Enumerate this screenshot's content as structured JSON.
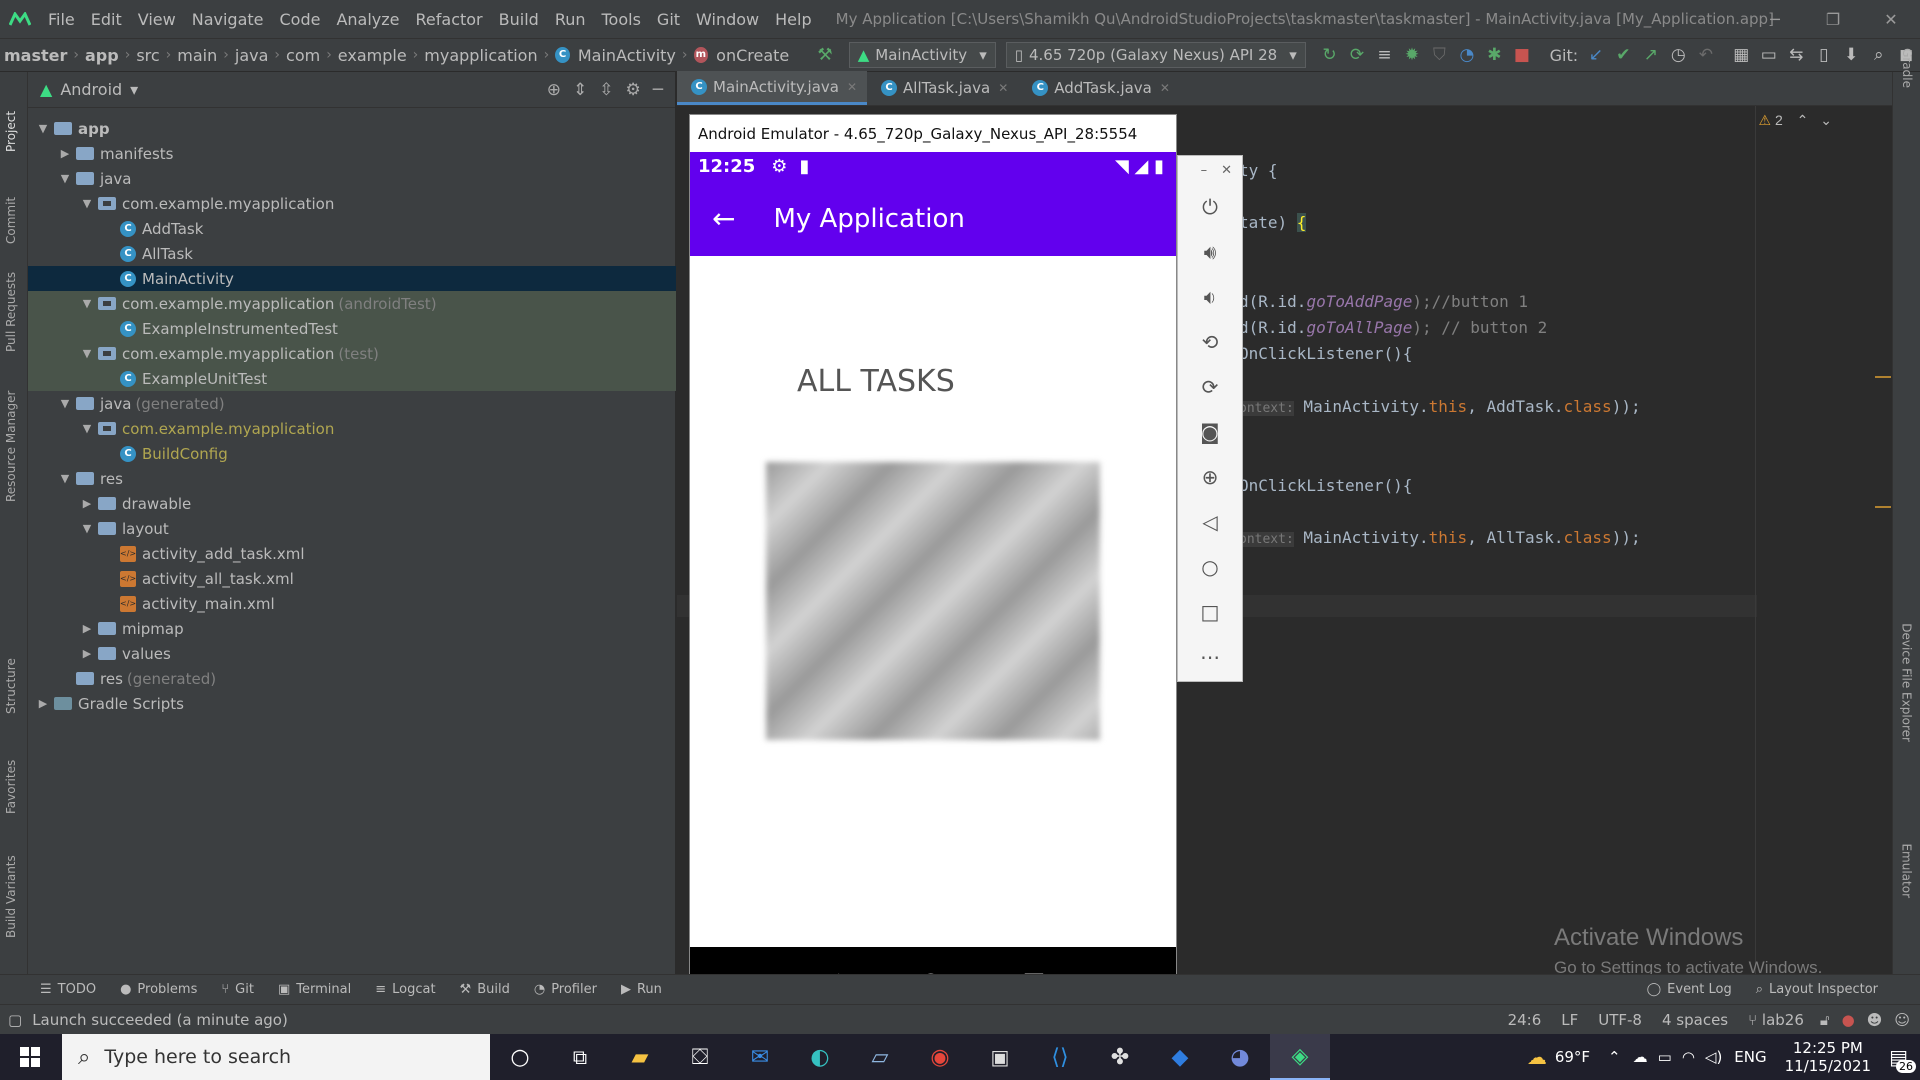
{
  "window": {
    "title": "My Application [C:\\Users\\Shamikh Qu\\AndroidStudioProjects\\taskmaster\\taskmaster] - MainActivity.java [My_Application.app]",
    "menus": [
      "File",
      "Edit",
      "View",
      "Navigate",
      "Code",
      "Analyze",
      "Refactor",
      "Build",
      "Run",
      "Tools",
      "Git",
      "Window",
      "Help"
    ]
  },
  "breadcrumb": [
    "master",
    "app",
    "src",
    "main",
    "java",
    "com",
    "example",
    "myapplication",
    "MainActivity",
    "onCreate"
  ],
  "toolbar": {
    "run_config": "MainActivity",
    "device": "4.65  720p (Galaxy Nexus) API 28",
    "git_label": "Git:"
  },
  "project": {
    "view": "Android",
    "tree": [
      {
        "label": "app",
        "kind": "module",
        "depth": 0,
        "open": true
      },
      {
        "label": "manifests",
        "kind": "folder",
        "depth": 1,
        "open": false
      },
      {
        "label": "java",
        "kind": "folder",
        "depth": 1,
        "open": true
      },
      {
        "label": "com.example.myapplication",
        "kind": "pkg",
        "depth": 2,
        "open": true
      },
      {
        "label": "AddTask",
        "kind": "class",
        "depth": 3
      },
      {
        "label": "AllTask",
        "kind": "class",
        "depth": 3
      },
      {
        "label": "MainActivity",
        "kind": "class",
        "depth": 3,
        "selected": true
      },
      {
        "label": "com.example.myapplication",
        "suffix": "(androidTest)",
        "kind": "pkg",
        "depth": 2,
        "open": true,
        "test": true
      },
      {
        "label": "ExampleInstrumentedTest",
        "kind": "class",
        "depth": 3,
        "test": true
      },
      {
        "label": "com.example.myapplication",
        "suffix": "(test)",
        "kind": "pkg",
        "depth": 2,
        "open": true,
        "test": true
      },
      {
        "label": "ExampleUnitTest",
        "kind": "class",
        "depth": 3,
        "test": true
      },
      {
        "label": "java",
        "suffix": "(generated)",
        "kind": "folder",
        "depth": 1,
        "open": true
      },
      {
        "label": "com.example.myapplication",
        "kind": "pkg",
        "depth": 2,
        "open": true,
        "generated": true
      },
      {
        "label": "BuildConfig",
        "kind": "class",
        "depth": 3,
        "generated": true
      },
      {
        "label": "res",
        "kind": "folder",
        "depth": 1,
        "open": true
      },
      {
        "label": "drawable",
        "kind": "folder",
        "depth": 2,
        "open": false
      },
      {
        "label": "layout",
        "kind": "folder",
        "depth": 2,
        "open": true
      },
      {
        "label": "activity_add_task.xml",
        "kind": "xml",
        "depth": 3
      },
      {
        "label": "activity_all_task.xml",
        "kind": "xml",
        "depth": 3
      },
      {
        "label": "activity_main.xml",
        "kind": "xml",
        "depth": 3
      },
      {
        "label": "mipmap",
        "kind": "folder",
        "depth": 2,
        "open": false
      },
      {
        "label": "values",
        "kind": "folder",
        "depth": 2,
        "open": false
      },
      {
        "label": "res",
        "suffix": "(generated)",
        "kind": "folder",
        "depth": 1,
        "leaf": true
      },
      {
        "label": "Gradle Scripts",
        "kind": "gradle",
        "depth": 0,
        "open": false
      }
    ]
  },
  "tabs": [
    {
      "label": "MainActivity.java",
      "active": true
    },
    {
      "label": "AllTask.java",
      "active": false
    },
    {
      "label": "AddTask.java",
      "active": false
    }
  ],
  "editor": {
    "warnings": "2",
    "line1": "ty {",
    "line2": "tate) ",
    "line3a": "d(R.id.",
    "line3b": "goToAddPage",
    "line3c": ");//button 1",
    "line4a": "d(R.id.",
    "line4b": "goToAllPage",
    "line4c": "); // button 2",
    "line5": "OnClickListener(){",
    "line6hint": "ontext:",
    "line6": " MainActivity.",
    "line6b": "this",
    "line6c": ", AddTask.",
    "line6d": "class",
    "line6e": "));",
    "line7": "OnClickListener(){",
    "line8hint": "ontext:",
    "line8": " MainActivity.",
    "line8b": "this",
    "line8c": ", AllTask.",
    "line8d": "class",
    "line8e": "));"
  },
  "watermark": {
    "title": "Activate Windows",
    "sub": "Go to Settings to activate Windows."
  },
  "emulator": {
    "title": "Android Emulator - 4.65_720p_Galaxy_Nexus_API_28:5554",
    "time": "12:25",
    "app_title": "My Application",
    "heading": "ALL TASKS"
  },
  "left_tools": [
    "Project",
    "Commit",
    "Pull Requests",
    "Resource Manager",
    "Structure",
    "Favorites",
    "Build Variants"
  ],
  "right_tools": [
    "Gradle",
    "Device File Explorer",
    "Emulator"
  ],
  "bottom_tabs": [
    "TODO",
    "Problems",
    "Git",
    "Terminal",
    "Logcat",
    "Build",
    "Profiler",
    "Run"
  ],
  "bottom_right": [
    "Event Log",
    "Layout Inspector"
  ],
  "status": {
    "message": "Launch succeeded (a minute ago)",
    "position": "24:6",
    "line_sep": "LF",
    "encoding": "UTF-8",
    "indent": "4 spaces",
    "branch": "lab26"
  },
  "taskbar": {
    "search_placeholder": "Type here to search",
    "temp": "69°F",
    "lang": "ENG",
    "time": "12:25 PM",
    "date": "11/15/2021",
    "notif": "26"
  }
}
